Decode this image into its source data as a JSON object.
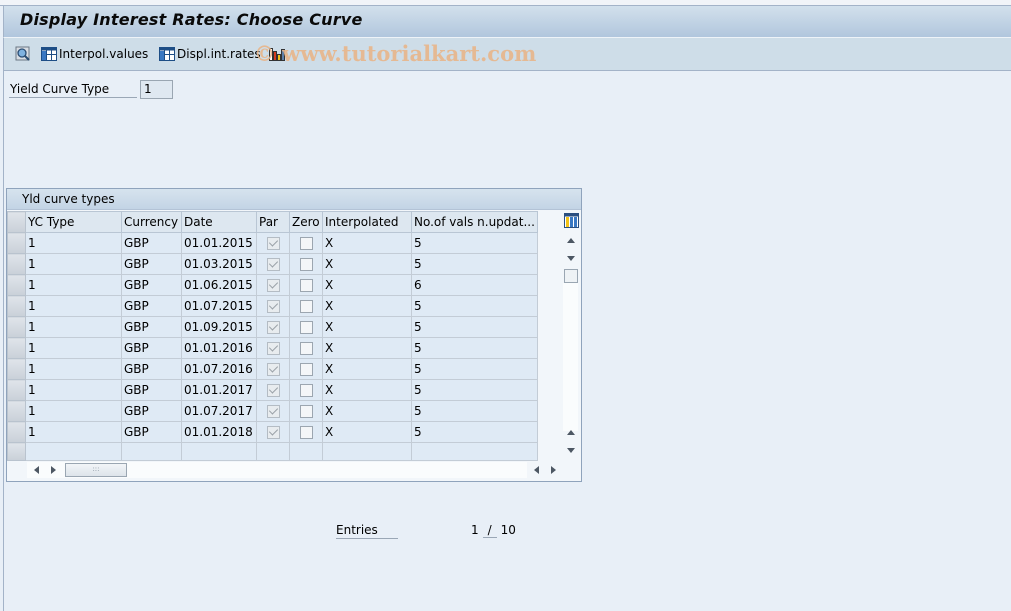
{
  "window": {
    "title": "Display Interest Rates: Choose Curve"
  },
  "toolbar": {
    "items": [
      {
        "icon": "find-icon",
        "label": ""
      },
      {
        "icon": "table-icon",
        "label": "Interpol.values"
      },
      {
        "icon": "table-icon",
        "label": "Displ.int.rates"
      },
      {
        "icon": "chart-icon",
        "label": ""
      }
    ],
    "watermark": "© www.tutorialkart.com"
  },
  "selection": {
    "yield_curve_type_label": "Yield Curve Type",
    "yield_curve_type_value": "1"
  },
  "grid": {
    "title": "Yld curve types",
    "columns": [
      "YC Type",
      "Currency",
      "Date",
      "Par",
      "Zero",
      "Interpolated",
      "No.of vals n.updat..."
    ],
    "rows": [
      {
        "yc_type": "1",
        "currency": "GBP",
        "date": "01.01.2015",
        "par": true,
        "zero": false,
        "interpolated": "X",
        "no_vals": "5"
      },
      {
        "yc_type": "1",
        "currency": "GBP",
        "date": "01.03.2015",
        "par": true,
        "zero": false,
        "interpolated": "X",
        "no_vals": "5"
      },
      {
        "yc_type": "1",
        "currency": "GBP",
        "date": "01.06.2015",
        "par": true,
        "zero": false,
        "interpolated": "X",
        "no_vals": "6"
      },
      {
        "yc_type": "1",
        "currency": "GBP",
        "date": "01.07.2015",
        "par": true,
        "zero": false,
        "interpolated": "X",
        "no_vals": "5"
      },
      {
        "yc_type": "1",
        "currency": "GBP",
        "date": "01.09.2015",
        "par": true,
        "zero": false,
        "interpolated": "X",
        "no_vals": "5"
      },
      {
        "yc_type": "1",
        "currency": "GBP",
        "date": "01.01.2016",
        "par": true,
        "zero": false,
        "interpolated": "X",
        "no_vals": "5"
      },
      {
        "yc_type": "1",
        "currency": "GBP",
        "date": "01.07.2016",
        "par": true,
        "zero": false,
        "interpolated": "X",
        "no_vals": "5"
      },
      {
        "yc_type": "1",
        "currency": "GBP",
        "date": "01.01.2017",
        "par": true,
        "zero": false,
        "interpolated": "X",
        "no_vals": "5"
      },
      {
        "yc_type": "1",
        "currency": "GBP",
        "date": "01.07.2017",
        "par": true,
        "zero": false,
        "interpolated": "X",
        "no_vals": "5"
      },
      {
        "yc_type": "1",
        "currency": "GBP",
        "date": "01.01.2018",
        "par": true,
        "zero": false,
        "interpolated": "X",
        "no_vals": "5"
      }
    ]
  },
  "footer": {
    "entries_label": "Entries",
    "current": "1",
    "separator": "/",
    "total": "10"
  }
}
